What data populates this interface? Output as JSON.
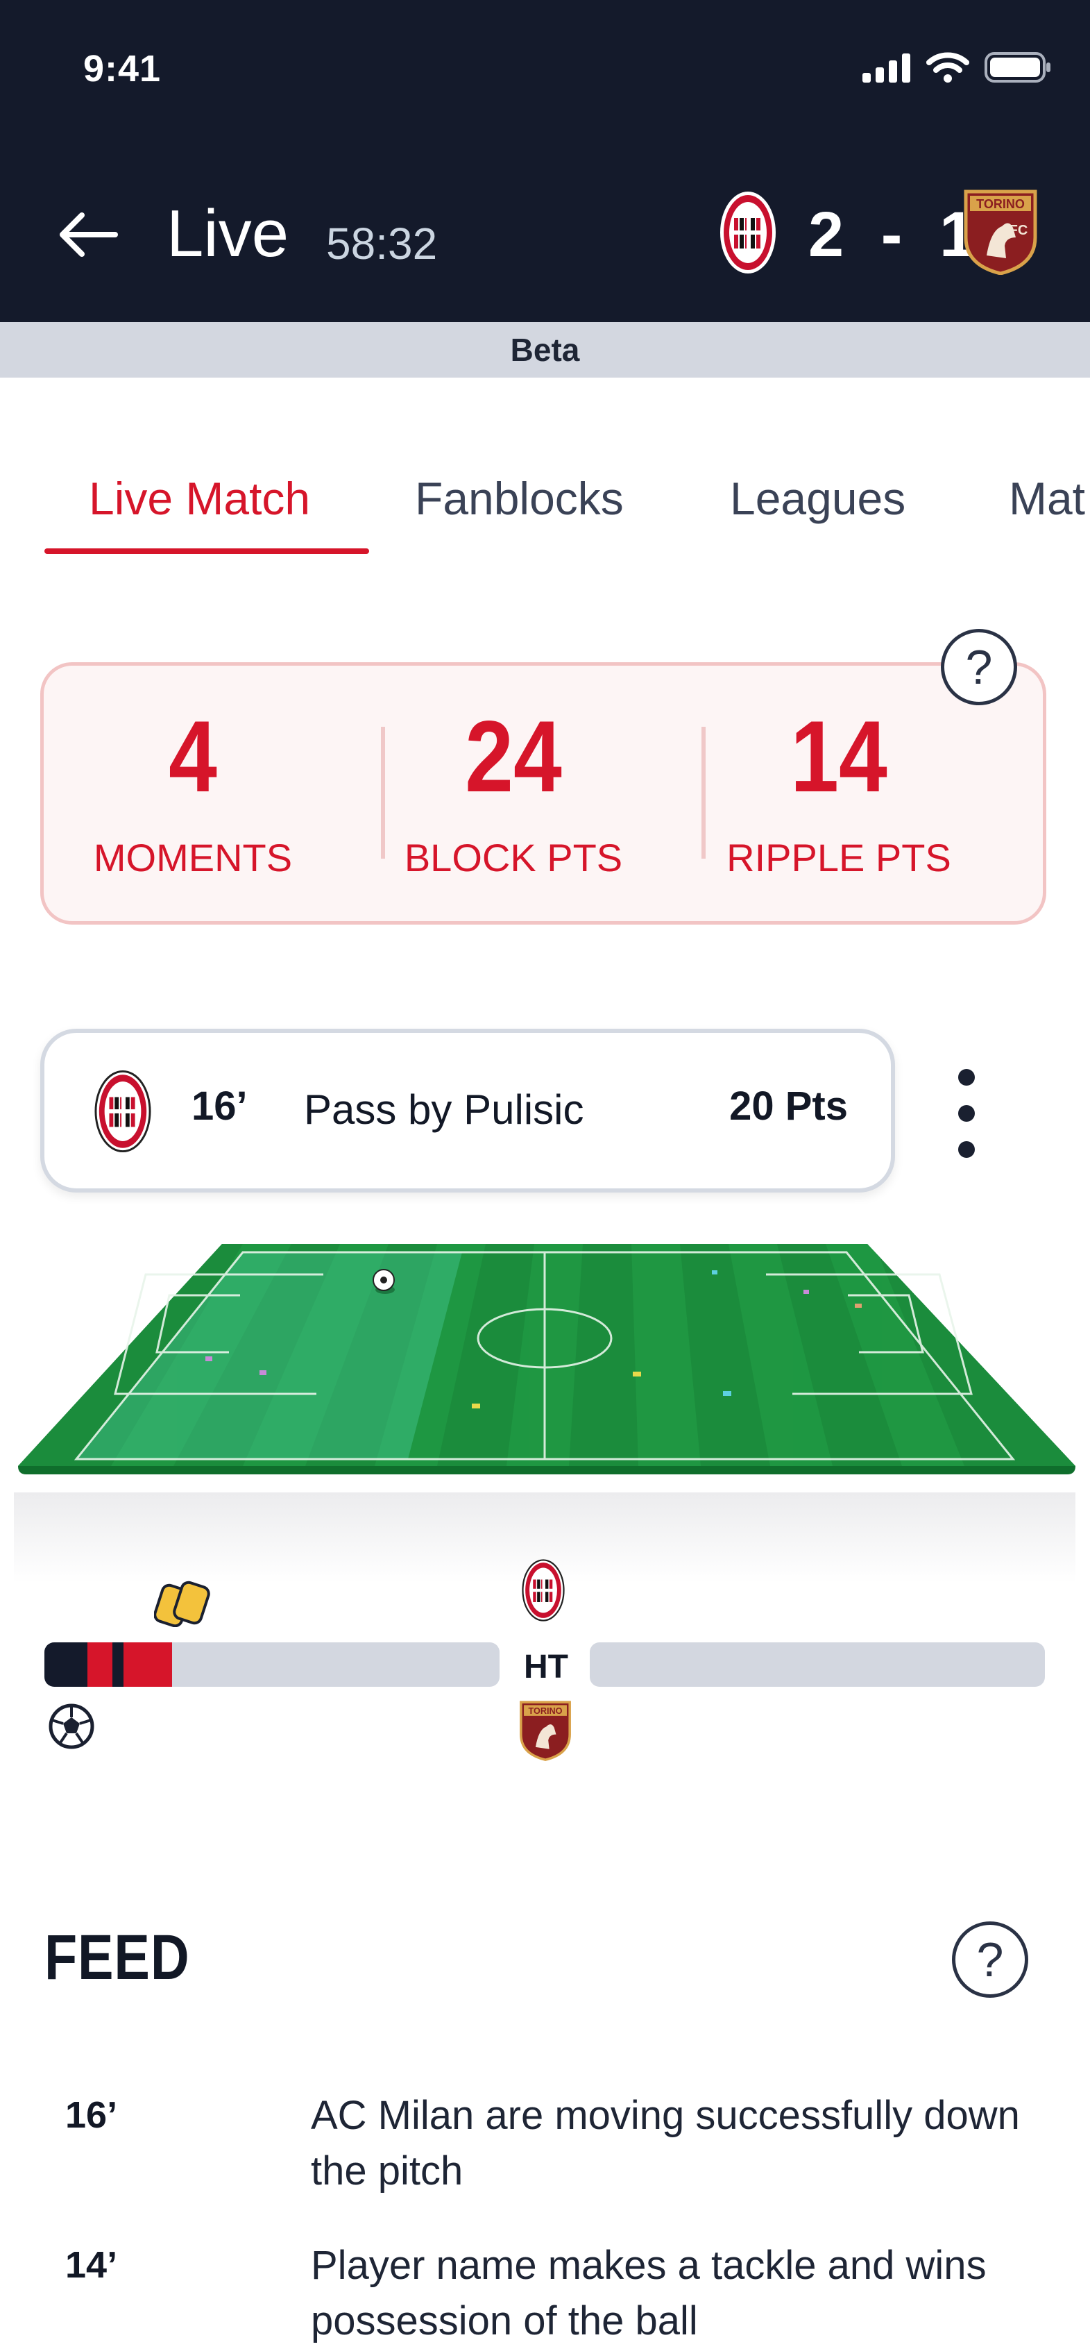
{
  "status_bar": {
    "time": "9:41"
  },
  "header": {
    "title": "Live",
    "clock": "58:32",
    "home_team": "AC Milan",
    "away_team": "Torino",
    "score_home": "2",
    "score_separator": "-",
    "score_away": "1",
    "beta_label": "Beta"
  },
  "tabs": [
    {
      "label": "Live Match",
      "active": true
    },
    {
      "label": "Fanblocks",
      "active": false
    },
    {
      "label": "Leagues",
      "active": false
    },
    {
      "label": "Mat",
      "active": false
    }
  ],
  "stats": {
    "moments": {
      "value": "4",
      "label": "MOMENTS"
    },
    "block_pts": {
      "value": "24",
      "label": "BLOCK PTS"
    },
    "ripple_pts": {
      "value": "14",
      "label": "RIPPLE PTS"
    },
    "help_icon": "question-icon"
  },
  "moment": {
    "minute": "16’",
    "description": "Pass by Pulisic",
    "points": "20 Pts",
    "crest": "ac-milan-crest"
  },
  "momentum": {
    "ht_label": "HT",
    "first_half_fill": 0.28,
    "second_half_fill": 0.0,
    "card_icon": "yellow-cards-icon",
    "goal_icon": "soccer-ball-icon"
  },
  "feed": {
    "title": "FEED",
    "items": [
      {
        "minute": "16’",
        "text": "AC Milan are moving successfully down the pitch"
      },
      {
        "minute": "14’",
        "text": "Player name makes a tackle and wins possession of the ball"
      }
    ]
  },
  "colors": {
    "accent": "#d6152a",
    "header_bg": "#141a2b",
    "beta_bg": "#d3d7e0",
    "pitch_green": "#1f8a3a"
  }
}
